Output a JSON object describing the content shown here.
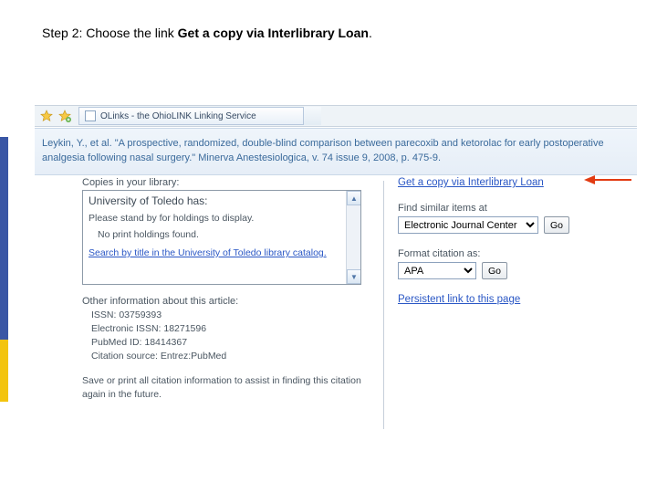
{
  "instruction": {
    "prefix": "Step 2: Choose the link ",
    "bold": "Get a copy via Interlibrary Loan",
    "suffix": "."
  },
  "browser": {
    "tab_title": "OLinks - the OhioLINK Linking Service"
  },
  "citation": "Leykin, Y., et al. \"A prospective, randomized, double-blind comparison between parecoxib and ketorolac for early postoperative analgesia following nasal surgery.\" Minerva Anestesiologica, v. 74 issue 9, 2008, p. 475-9.",
  "left": {
    "copies_label": "Copies in your library:",
    "holdings_title": "University of Toledo has:",
    "holdings_wait": "Please stand by for holdings to display.",
    "holdings_none": "No print holdings found.",
    "search_link": "Search by title in the University of Toledo library catalog.",
    "other_label": "Other information about this article:",
    "issn_row": "ISSN: 03759393",
    "eissn_row": "Electronic ISSN: 18271596",
    "pmid_row": "PubMed ID: 18414367",
    "src_row": "Citation source: Entrez:PubMed",
    "save_note": "Save or print all citation information to assist in finding this citation again in the future."
  },
  "right": {
    "ill_link": "Get a copy via Interlibrary Loan",
    "similar_label": "Find similar items at",
    "similar_selected": "Electronic Journal Center",
    "citation_label": "Format citation as:",
    "citation_selected": "APA",
    "go_label": "Go",
    "persistent_link": "Persistent link to this page"
  }
}
